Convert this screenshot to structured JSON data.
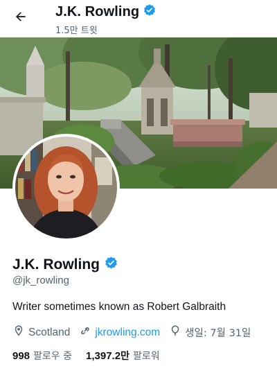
{
  "header": {
    "name": "J.K. Rowling",
    "tweet_count": "1.5만 트윗",
    "icons": {
      "back": "arrow-left-icon",
      "verified": "verified-badge-icon"
    }
  },
  "profile": {
    "name": "J.K. Rowling",
    "handle": "@jk_rowling",
    "bio": "Writer sometimes known as Robert Galbraith",
    "location": "Scotland",
    "website": "jkrowling.com",
    "birthday": "생일: 7월 31일",
    "icons": {
      "location": "location-pin-icon",
      "link": "link-icon",
      "birthday": "balloon-icon"
    }
  },
  "stats": {
    "following_count": "998",
    "following_label": "팔로우 중",
    "followers_count": "1,397.2",
    "followers_unit": "만",
    "followers_label": "팔로워"
  },
  "colors": {
    "accent": "#1d9bf0",
    "text_primary": "#0f1419",
    "text_secondary": "#536471"
  }
}
